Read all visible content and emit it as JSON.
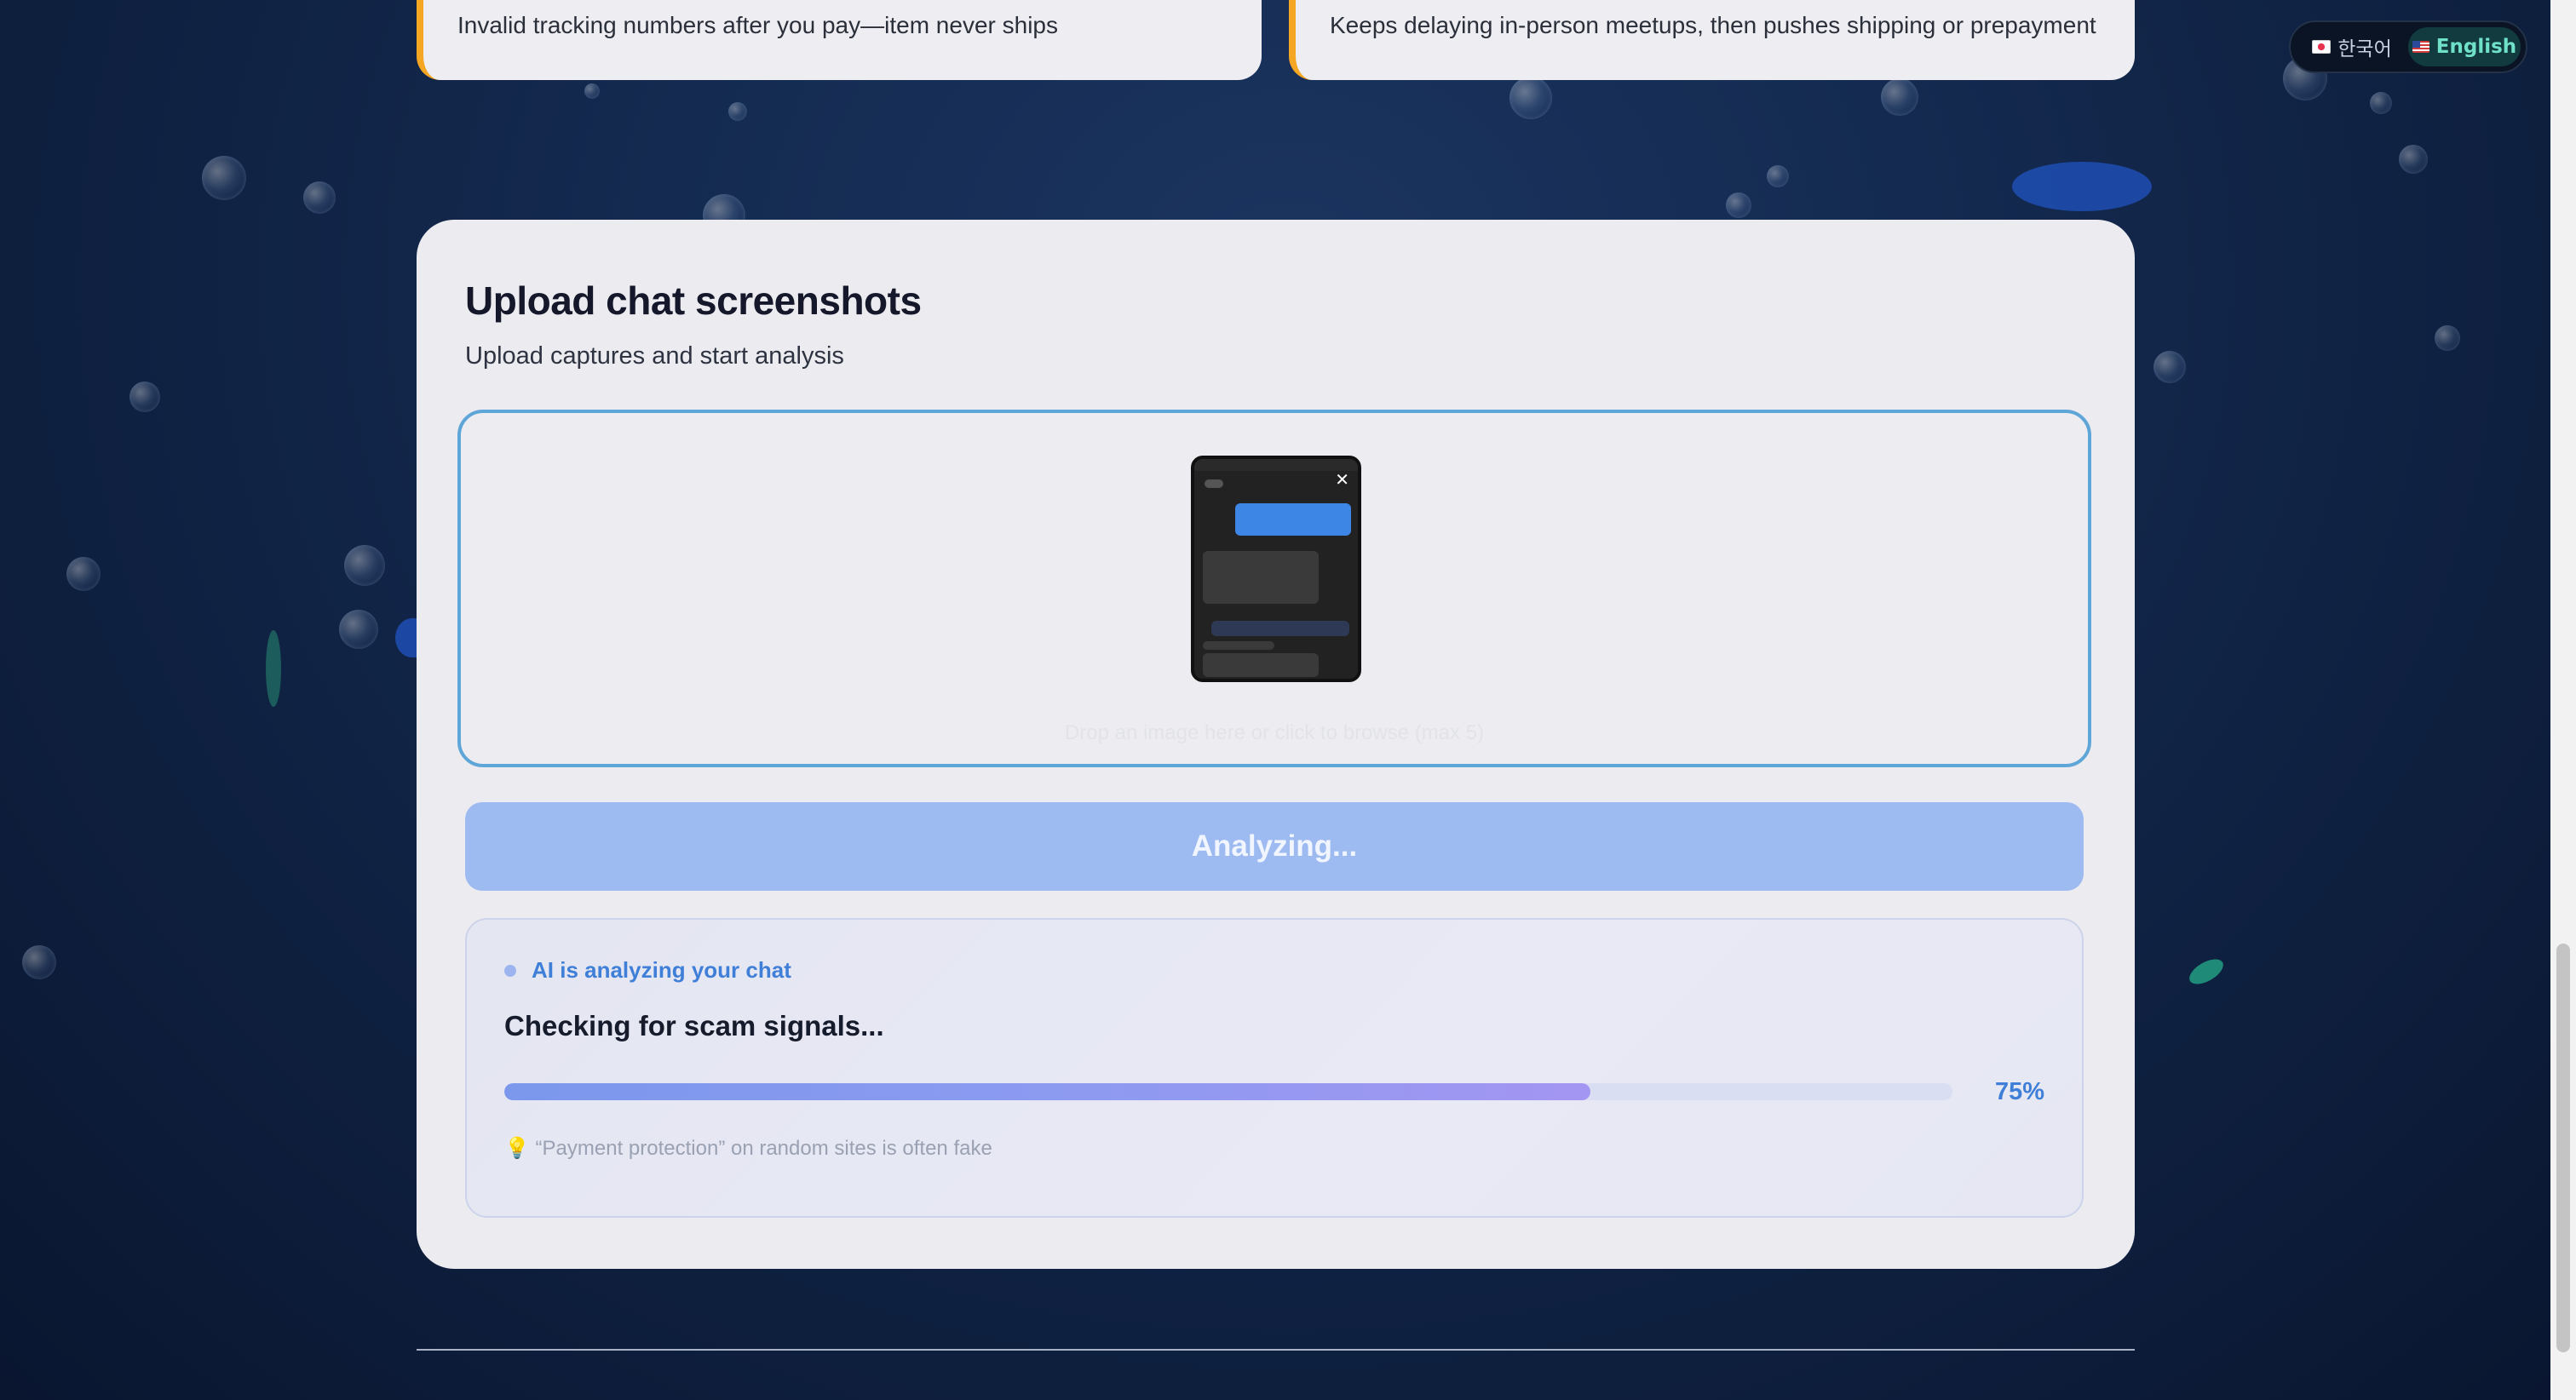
{
  "warning_cards": [
    {
      "text": "Invalid tracking numbers after you pay—item never ships"
    },
    {
      "text": "Keeps delaying in-person meetups, then pushes shipping or prepayment"
    }
  ],
  "language_switcher": {
    "options": [
      {
        "label": "한국어",
        "icon": "kr-flag-icon"
      },
      {
        "label": "English",
        "icon": "us-flag-icon",
        "selected": true
      }
    ]
  },
  "upload_section": {
    "title": "Upload chat screenshots",
    "subtitle": "Upload captures and start analysis",
    "preview_close_icon": "close-icon",
    "dropzone_hint": "Drop an image here or click to browse (max 5)",
    "analyze_button_label": "Analyzing..."
  },
  "analysis": {
    "status_label": "AI is analyzing your chat",
    "current_step": "Checking for scam signals...",
    "progress_percent": 75,
    "progress_label": "75%",
    "tip": "💡 “Payment protection” on random sites is often fake"
  },
  "colors": {
    "accent_blue": "#3f7fd8",
    "warning_orange": "#f5a623",
    "button_disabled": "#9dbaf1",
    "dropzone_border": "#5fa6d8",
    "lang_active": "#6fe1c9"
  }
}
